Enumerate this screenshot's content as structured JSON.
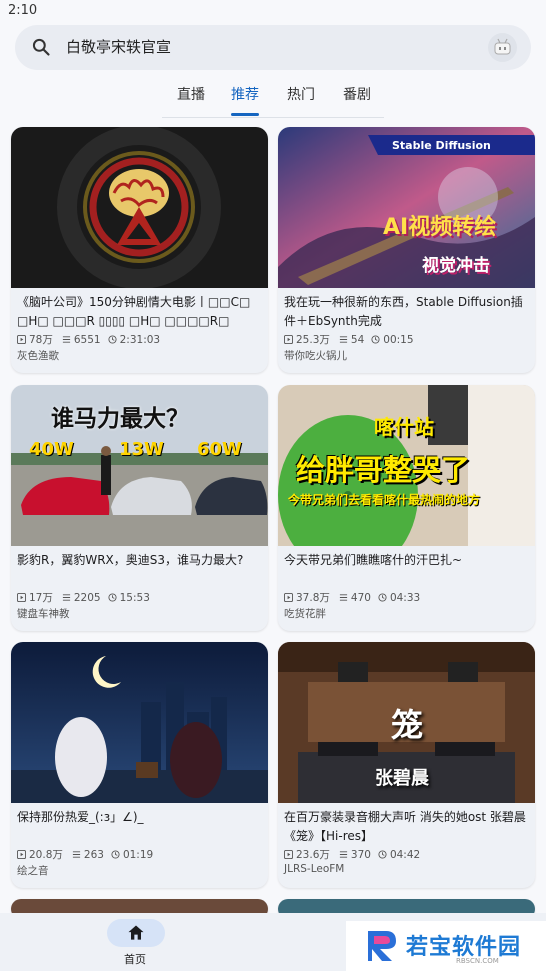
{
  "status_bar": {
    "time": "2:10"
  },
  "search": {
    "query": "白敬亭宋轶官宣"
  },
  "tabs": [
    {
      "label": "直播"
    },
    {
      "label": "推荐",
      "active": true
    },
    {
      "label": "热门"
    },
    {
      "label": "番剧"
    }
  ],
  "videos": [
    {
      "title": "《脑叶公司》150分钟剧情大电影丨□□C□ □H□ □□□R ▯▯▯▯ □H□ □□□□R□",
      "views": "78万",
      "danmaku": "6551",
      "duration": "2:31:03",
      "author": "灰色渔歌"
    },
    {
      "title": "我在玩一种很新的东西，Stable Diffusion插件＋EbSynth完成",
      "views": "25.3万",
      "danmaku": "54",
      "duration": "00:15",
      "author": "带你吃火锅儿",
      "thumb_text_1": "Stable Diffusion",
      "thumb_text_2": "AI视频转绘",
      "thumb_text_3": "视觉冲击"
    },
    {
      "title": "影豹R，翼豹WRX，奥迪S3，谁马力最大?",
      "views": "17万",
      "danmaku": "2205",
      "duration": "15:53",
      "author": "键盘车神教",
      "thumb_text_1": "谁马力最大？",
      "thumb_text_2": "40W",
      "thumb_text_3": "13W",
      "thumb_text_4": "60W"
    },
    {
      "title": "今天带兄弟们瞧瞧喀什的汗巴扎~",
      "views": "37.8万",
      "danmaku": "470",
      "duration": "04:33",
      "author": "吃货花胖",
      "thumb_text_1": "喀什站",
      "thumb_text_2": "给胖哥整哭了",
      "thumb_text_3": "今带兄弟们去看看喀什最热闹的地方"
    },
    {
      "title": "保持那份热爱_(:з」∠)_",
      "views": "20.8万",
      "danmaku": "263",
      "duration": "01:19",
      "author": "绘之音"
    },
    {
      "title": "在百万豪装录音棚大声听 消失的她ost 张碧晨《笼》【Hi-res】",
      "views": "23.6万",
      "danmaku": "370",
      "duration": "04:42",
      "author": "JLRS-LeoFM",
      "thumb_text_1": "笼",
      "thumb_text_2": "张碧晨"
    }
  ],
  "bottom_nav": {
    "home_label": "首页"
  },
  "watermark": {
    "text": "若宝软件园",
    "sub": "RBSCN.COM"
  },
  "colors": {
    "accent": "#1565c0",
    "background": "#f7f8fb",
    "card": "#eef1f6"
  }
}
